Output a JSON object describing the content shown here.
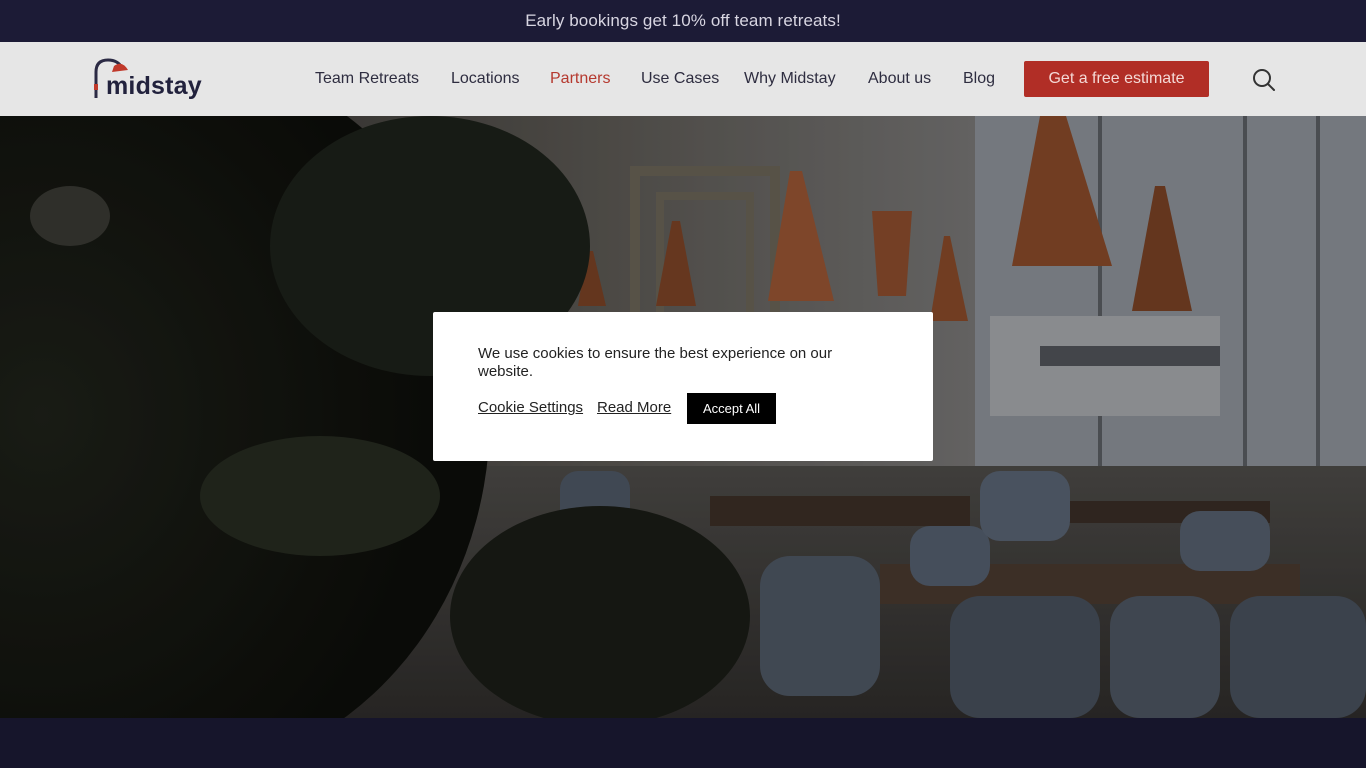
{
  "announcement": {
    "text": "Early bookings get 10% off team retreats!"
  },
  "header": {
    "logo_text": "midstay",
    "nav": [
      {
        "label": "Team Retreats"
      },
      {
        "label": "Locations"
      },
      {
        "label": "Partners"
      },
      {
        "label": "Use Cases"
      },
      {
        "label": "Why Midstay"
      },
      {
        "label": "About us"
      },
      {
        "label": "Blog"
      }
    ],
    "active_nav": "Partners",
    "cta_label": "Get a free estimate",
    "search_icon": "search-icon"
  },
  "cookie_banner": {
    "message": "We use cookies to ensure the best experience on our website.",
    "settings_label": "Cookie Settings",
    "read_more_label": "Read More",
    "accept_label": "Accept All"
  },
  "colors": {
    "announcement_bg": "#1c1b36",
    "header_bg": "#e6e6e6",
    "accent": "#b12e26",
    "active_nav": "#b5392f",
    "dark_band": "#16152b"
  }
}
